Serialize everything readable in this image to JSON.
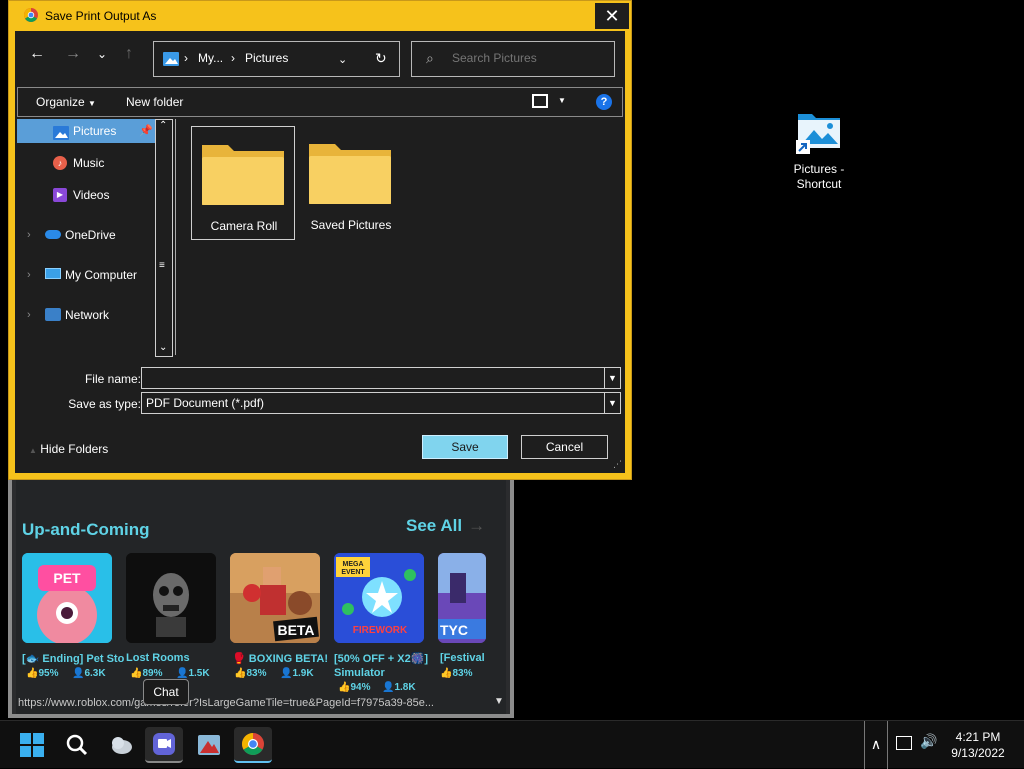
{
  "desktop": {
    "shortcut_label": "Pictures - Shortcut"
  },
  "dialog": {
    "title": "Save Print Output As",
    "close_glyph": "✕",
    "nav": {
      "back": "←",
      "forward": "→",
      "recent": "⌄",
      "up": "↑"
    },
    "address": {
      "crumb1": "My...",
      "crumb2": "Pictures",
      "sep": "›",
      "refresh": "↻"
    },
    "search_placeholder": "Search Pictures",
    "toolbar": {
      "organize": "Organize",
      "new_folder": "New folder",
      "help": "?"
    },
    "sidebar": {
      "items": [
        {
          "label": "Pictures",
          "icon": "pictures-icon",
          "selected": true
        },
        {
          "label": "Music",
          "icon": "music-icon"
        },
        {
          "label": "Videos",
          "icon": "videos-icon"
        },
        {
          "label": "OneDrive",
          "icon": "onedrive-icon"
        },
        {
          "label": "My Computer",
          "icon": "computer-icon"
        },
        {
          "label": "Network",
          "icon": "network-icon"
        }
      ]
    },
    "folders": [
      {
        "name": "Camera Roll",
        "selected": true
      },
      {
        "name": "Saved Pictures",
        "selected": false
      }
    ],
    "file_name_label": "File name:",
    "file_name_value": "",
    "save_type_label": "Save as type:",
    "save_type_value": "PDF Document (*.pdf)",
    "hide_folders": "Hide Folders",
    "save_button": "Save",
    "cancel_button": "Cancel"
  },
  "browser": {
    "section_title": "Up-and-Coming",
    "see_all": "See All",
    "see_all_chevron": "→",
    "games": [
      {
        "title": "[🐟 Ending] Pet Sto",
        "rating": "95%",
        "players": "6.3K",
        "art": "pet-story"
      },
      {
        "title": "Lost Rooms",
        "rating": "89%",
        "players": "1.5K",
        "art": "lost-rooms"
      },
      {
        "title": "🥊 BOXING BETA!",
        "rating": "83%",
        "players": "1.9K",
        "art": "boxing-beta"
      },
      {
        "title": "[50% OFF + X2🎆] Simulator",
        "rating": "94%",
        "players": "1.8K",
        "art": "firework-simulator"
      },
      {
        "title": "[Festival T",
        "rating": "83%",
        "players": "",
        "art": "festival-tycoon"
      }
    ],
    "status_url": "https://www.roblox.com/games/refer?IsLargeGameTile=true&PageId=f7975a39-85e...",
    "chat_tooltip": "Chat"
  },
  "taskbar": {
    "time": "4:21 PM",
    "date": "9/13/2022",
    "tray_chevron": "∧"
  },
  "colors": {
    "dialog_frame": "#f6c21b",
    "dark_bg": "#1e1e1e",
    "accent_cyan": "#5fd3e6",
    "save_button": "#80d4ee",
    "folder_yellow": "#f8d062"
  }
}
